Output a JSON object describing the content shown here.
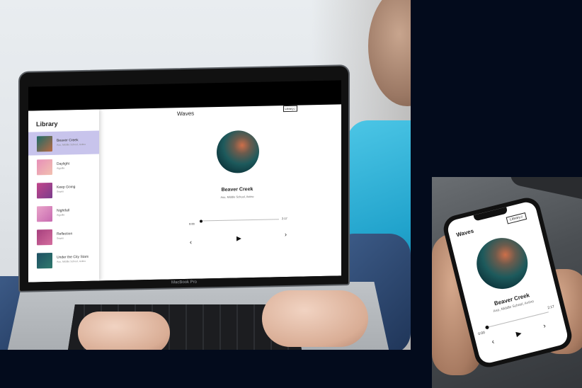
{
  "laptop": {
    "brand_label": "MacBook Pro"
  },
  "app": {
    "title": "Waves",
    "library_button": "Library",
    "library_title": "Library",
    "songs": [
      {
        "name": "Beaver Creek",
        "artist": "Aso, Middle School, Aviino",
        "active": true,
        "colors": [
          "#1c6b67",
          "#b96a44"
        ]
      },
      {
        "name": "Daylight",
        "artist": "Aiguille",
        "active": false,
        "colors": [
          "#e78fb8",
          "#f2c1b0"
        ]
      },
      {
        "name": "Keep Going",
        "artist": "Swørn",
        "active": false,
        "colors": [
          "#c2468b",
          "#7b3d8c"
        ]
      },
      {
        "name": "Nightfall",
        "artist": "Aiguille",
        "active": false,
        "colors": [
          "#e9a3c9",
          "#c76ab0"
        ]
      },
      {
        "name": "Reflection",
        "artist": "Swørn",
        "active": false,
        "colors": [
          "#a63f7d",
          "#d46e9e"
        ]
      },
      {
        "name": "Under the City Stars",
        "artist": "Aso, Middle School, Aviino",
        "active": false,
        "colors": [
          "#1e4f63",
          "#2f7a6d"
        ]
      }
    ],
    "now_playing": {
      "title": "Beaver Creek",
      "artist": "Aso, Middle School, Aviino",
      "current_time": "0:00",
      "duration": "2:17",
      "progress": 0.0
    },
    "controls": {
      "prev_icon": "chevron-left-icon",
      "play_icon": "play-icon",
      "next_icon": "chevron-right-icon"
    }
  },
  "phone": {
    "title": "Waves",
    "library_button": "Library",
    "song_title": "Beaver Creek",
    "song_artist": "Aso, Middle School, Aviino",
    "current_time": "0:00",
    "duration": "2:17"
  },
  "colors": {
    "background": "#030b1c",
    "active_song": "#c8c4ec"
  }
}
